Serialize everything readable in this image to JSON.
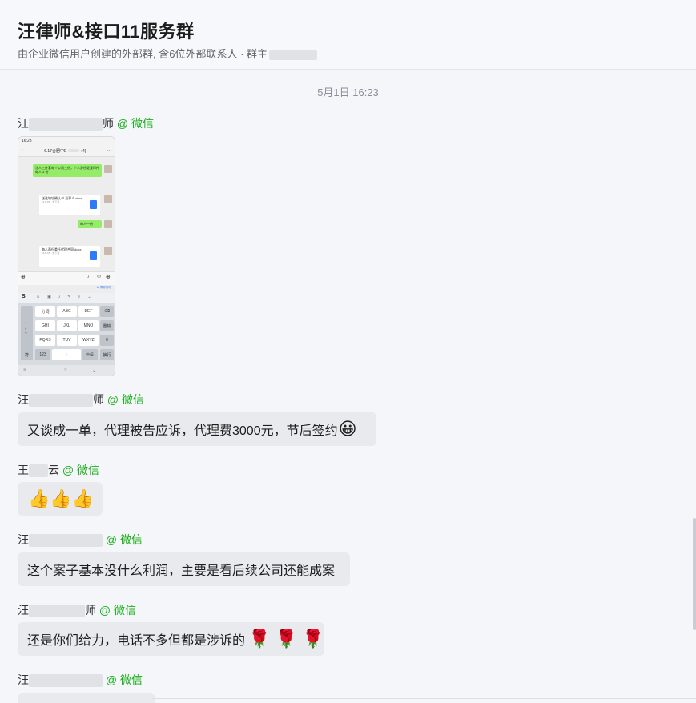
{
  "header": {
    "title": "汪律师&接口11服务群",
    "subtitle": "由企业微信用户创建的外部群, 含6位外部联系人 · 群主"
  },
  "chat": {
    "date": "5月1日 16:23",
    "messages": [
      {
        "sender_prefix": "汪",
        "sender_suffix": "师",
        "source": "@ 微信",
        "type": "image"
      },
      {
        "sender_prefix": "汪",
        "sender_suffix": "师",
        "source": "@ 微信",
        "text": "又谈成一单，代理被告应诉，代理费3000元，节后签约",
        "emoji": "😀"
      },
      {
        "sender_prefix": "王",
        "sender_suffix": "云",
        "source": "@ 微信",
        "emoji": "👍👍👍"
      },
      {
        "sender_prefix": "汪",
        "sender_suffix": "",
        "source": "@ 微信",
        "text": "这个案子基本没什么利润，主要是看后续公司还能成案"
      },
      {
        "sender_prefix": "汪",
        "sender_suffix": "师",
        "source": "@ 微信",
        "text": "还是你们给力，电话不多但都是涉诉的",
        "emoji": "🌹 🌹 🌹"
      },
      {
        "sender_prefix": "汪",
        "sender_suffix": "",
        "source": "@ 微信"
      }
    ]
  },
  "phone_screenshot": {
    "status_time": "16:23",
    "nav_title": "6.17合肥中E",
    "nav_count": "(4)",
    "msg1": "法人三件套每个公司三份，个人身份证复印件每人 3 份",
    "file1_name": "送达地址确认书.当事人.docx",
    "file1_meta": "16.8 KB · 未下载",
    "msg2": "每人一份",
    "file2_name": "每人两份委托代理合同.docx",
    "file2_meta": "16.8 KB · 未下载",
    "ai_hint": "AI 帮你修改",
    "keys_row1": [
      "分词",
      "ABC",
      "DEF"
    ],
    "keys_row2": [
      "GHI",
      "JKL",
      "MNO"
    ],
    "keys_row3": [
      "PQRS",
      "TUV",
      "WXYZ"
    ],
    "key_delete": "⌫",
    "key_reenter": "重输",
    "key_zero": "0",
    "key_symbol": "符",
    "key_123": "123",
    "key_space": "○",
    "key_cn": "中/英",
    "key_newline": "换行",
    "key_left": [
      "，",
      "。",
      "？",
      "！"
    ]
  }
}
